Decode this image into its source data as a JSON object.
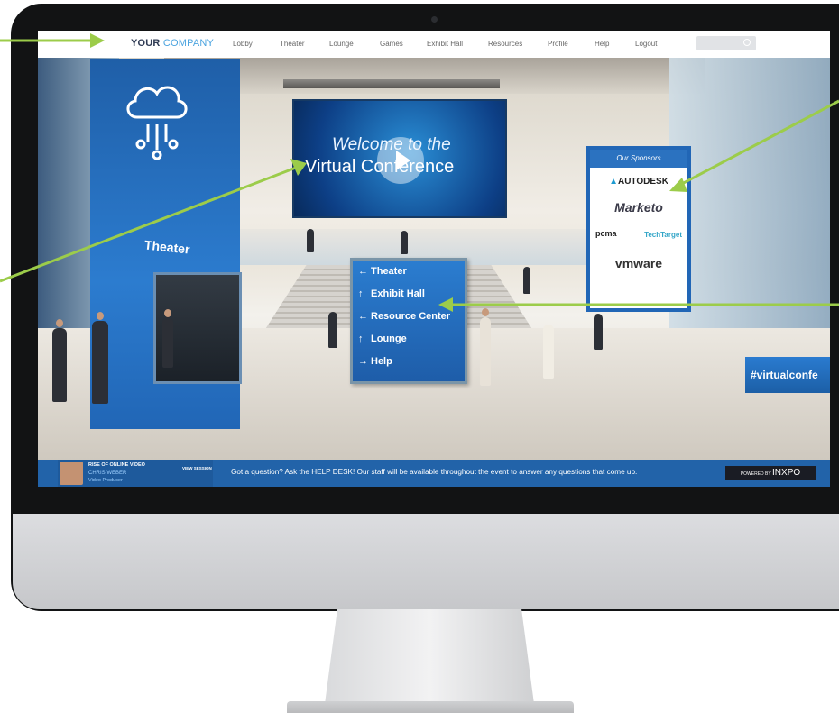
{
  "nav": {
    "brand_your": "YOUR",
    "brand_company": "COMPANY",
    "items": [
      "Lobby",
      "Theater",
      "Lounge",
      "Games",
      "Exhibit Hall",
      "Resources",
      "Profile",
      "Help",
      "Logout"
    ],
    "search_placeholder": ""
  },
  "scene": {
    "theater_label": "Theater",
    "video_line1": "Welcome to the",
    "video_line2": "Virtual Conference",
    "sponsors_header": "Our Sponsors",
    "sponsors": [
      "AUTODESK",
      "Marketo",
      "pcma",
      "TechTarget",
      "vmware"
    ],
    "signpost": [
      {
        "arrow": "←",
        "label": "Theater"
      },
      {
        "arrow": "↑",
        "label": "Exhibit Hall"
      },
      {
        "arrow": "←",
        "label": "Resource Center"
      },
      {
        "arrow": "↑",
        "label": "Lounge"
      },
      {
        "arrow": "→",
        "label": "Help"
      }
    ],
    "hashtag": "#virtualconfe"
  },
  "bottom": {
    "session_title": "RISE OF ONLINE VIDEO",
    "speaker_name": "CHRIS WEBER",
    "speaker_role": "Video Producer",
    "view_session": "VIEW SESSION",
    "help_message": "Got a question? Ask the HELP DESK! Our staff will be available throughout the event to answer any questions that come up.",
    "powered_by": "POWERED BY",
    "powered_brand": "INXPO"
  },
  "colors": {
    "accent_blue": "#2263a9",
    "arrow_green": "#9ccc4a",
    "brand_dark": "#2f3b54",
    "brand_light": "#4aa3df"
  }
}
